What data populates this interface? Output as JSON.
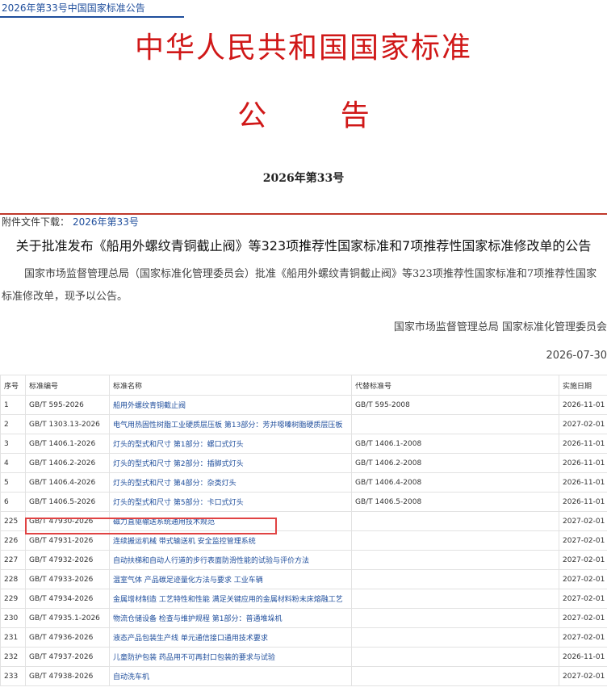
{
  "breadcrumb": "2026年第33号中国国家标准公告",
  "header": {
    "title": "中华人民共和国国家标准",
    "subtitle": "公 告",
    "issue_no": "2026年第33号"
  },
  "attachment": {
    "label": "附件文件下载：",
    "link": "2026年第33号"
  },
  "notice": {
    "title": "关于批准发布《船用外螺纹青铜截止阀》等323项推荐性国家标准和7项推荐性国家标准修改单的公告",
    "body": "国家市场监督管理总局（国家标准化管理委员会）批准《船用外螺纹青铜截止阀》等323项推荐性国家标准和7项推荐性国家标准修改单，现予以公告。",
    "signature": "国家市场监督管理总局 国家标准化管理委员会",
    "date": "2026-07-30"
  },
  "table": {
    "headers": [
      "序号",
      "标准编号",
      "标准名称",
      "代替标准号",
      "实施日期"
    ],
    "rows": [
      [
        "1",
        "GB/T 595-2026",
        "船用外螺纹青铜截止阀",
        "GB/T 595-2008",
        "2026-11-01"
      ],
      [
        "2",
        "GB/T 1303.13-2026",
        "电气用热固性树脂工业硬质层压板 第13部分：芳并噁嗪树脂硬质层压板",
        "",
        "2027-02-01"
      ],
      [
        "3",
        "GB/T 1406.1-2026",
        "灯头的型式和尺寸 第1部分：螺口式灯头",
        "GB/T 1406.1-2008",
        "2026-11-01"
      ],
      [
        "4",
        "GB/T 1406.2-2026",
        "灯头的型式和尺寸 第2部分：插脚式灯头",
        "GB/T 1406.2-2008",
        "2026-11-01"
      ],
      [
        "5",
        "GB/T 1406.4-2026",
        "灯头的型式和尺寸 第4部分：杂类灯头",
        "GB/T 1406.4-2008",
        "2026-11-01"
      ],
      [
        "6",
        "GB/T 1406.5-2026",
        "灯头的型式和尺寸 第5部分：卡口式灯头",
        "GB/T 1406.5-2008",
        "2026-11-01"
      ],
      [
        "225",
        "GB/T 47930-2026",
        "磁力直驱输送系统通用技术规范",
        "",
        "2027-02-01"
      ],
      [
        "226",
        "GB/T 47931-2026",
        "连续搬运机械 带式输送机 安全监控管理系统",
        "",
        "2027-02-01"
      ],
      [
        "227",
        "GB/T 47932-2026",
        "自动扶梯和自动人行道的步行表面防滑性能的试验与评价方法",
        "",
        "2027-02-01"
      ],
      [
        "228",
        "GB/T 47933-2026",
        "温室气体 产品碳足迹量化方法与要求 工业车辆",
        "",
        "2027-02-01"
      ],
      [
        "229",
        "GB/T 47934-2026",
        "金属增材制造 工艺特性和性能 满足关键应用的金属材料粉末床熔融工艺",
        "",
        "2027-02-01"
      ],
      [
        "230",
        "GB/T 47935.1-2026",
        "物流仓储设备 检查与维护规程 第1部分：普通堆垛机",
        "",
        "2027-02-01"
      ],
      [
        "231",
        "GB/T 47936-2026",
        "液态产品包装生产线 单元通信接口通用技术要求",
        "",
        "2027-02-01"
      ],
      [
        "232",
        "GB/T 47937-2026",
        "儿童防护包装 药品用不可再封口包装的要求与试验",
        "",
        "2026-11-01"
      ],
      [
        "233",
        "GB/T 47938-2026",
        "自动洗车机",
        "",
        "2027-02-01"
      ]
    ]
  },
  "colors": {
    "header_red": "#d01818",
    "link_blue": "#1f4e9c",
    "highlight_box": "#e04343"
  }
}
